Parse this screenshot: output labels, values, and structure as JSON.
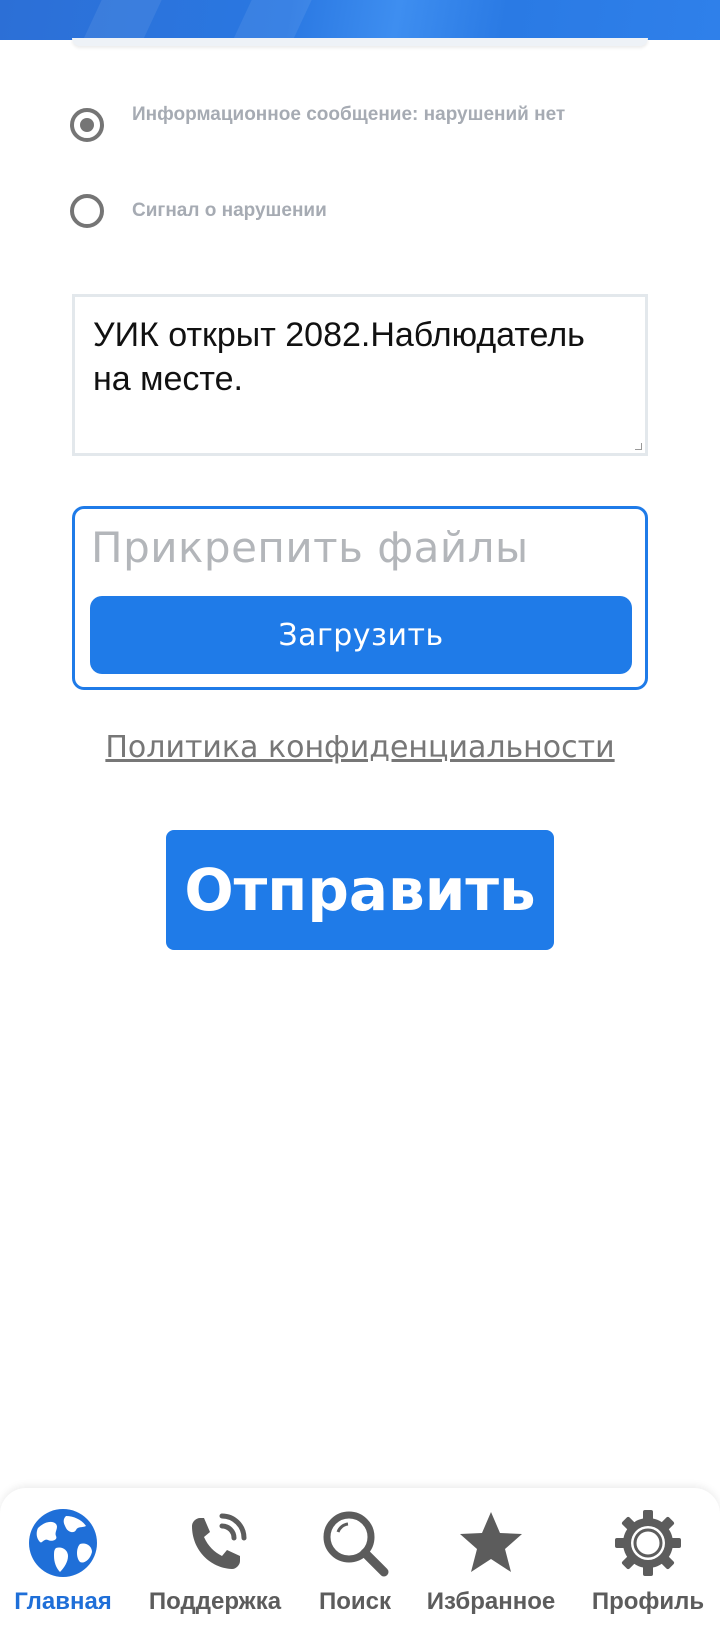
{
  "options": [
    {
      "label": "Информационное сообщение: нарушений нет",
      "checked": true
    },
    {
      "label": "Сигнал о нарушении",
      "checked": false
    }
  ],
  "message": {
    "value": "УИК открыт 2082.Наблюдатель на месте."
  },
  "attach": {
    "title": "Прикрепить файлы",
    "upload_label": "Загрузить"
  },
  "privacy_link": "Политика конфиденциальности",
  "submit_label": "Отправить",
  "nav": {
    "items": [
      {
        "label": "Главная",
        "icon": "globe-icon",
        "active": true
      },
      {
        "label": "Поддержка",
        "icon": "phone-icon",
        "active": false
      },
      {
        "label": "Поиск",
        "icon": "search-icon",
        "active": false
      },
      {
        "label": "Избранное",
        "icon": "star-icon",
        "active": false
      },
      {
        "label": "Профиль",
        "icon": "gear-icon",
        "active": false
      }
    ]
  },
  "colors": {
    "accent": "#1f7be8",
    "nav_active": "#1f6fd8",
    "nav_inactive": "#5c5c5c"
  }
}
